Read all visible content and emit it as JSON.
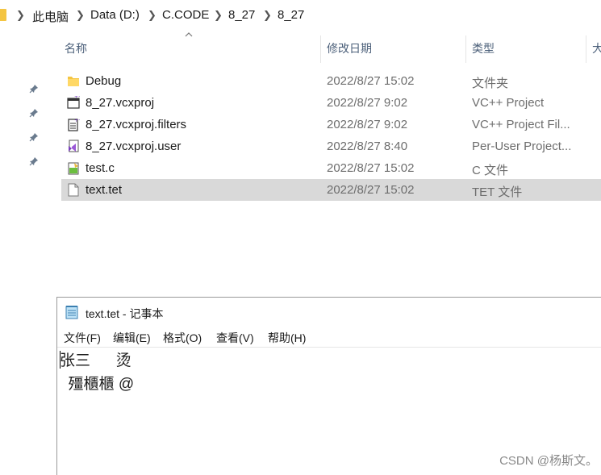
{
  "breadcrumb": [
    "此电脑",
    "Data (D:)",
    "C.CODE",
    "8_27",
    "8_27"
  ],
  "columns": {
    "name": "名称",
    "date": "修改日期",
    "type": "类型",
    "size": "大"
  },
  "files": [
    {
      "name": "Debug",
      "date": "2022/8/27 15:02",
      "type": "文件夹",
      "icon": "folder-icon"
    },
    {
      "name": "8_27.vcxproj",
      "date": "2022/8/27 9:02",
      "type": "VC++ Project",
      "icon": "vcxproj-icon"
    },
    {
      "name": "8_27.vcxproj.filters",
      "date": "2022/8/27 9:02",
      "type": "VC++ Project Fil...",
      "icon": "filters-icon"
    },
    {
      "name": "8_27.vcxproj.user",
      "date": "2022/8/27 8:40",
      "type": "Per-User Project...",
      "icon": "vs-user-icon"
    },
    {
      "name": "test.c",
      "date": "2022/8/27 15:02",
      "type": "C 文件",
      "icon": "c-file-icon"
    },
    {
      "name": "text.tet",
      "date": "2022/8/27 15:02",
      "type": "TET 文件",
      "icon": "blank-file-icon",
      "selected": true
    }
  ],
  "notepad": {
    "title": "text.tet - 记事本",
    "menu": [
      "文件(F)",
      "编辑(E)",
      "格式(O)",
      "查看(V)",
      "帮助(H)"
    ],
    "content_line1": "张三      烫",
    "content_line2": "  殭櫃櫃 @"
  },
  "watermark": "CSDN @杨斯文。",
  "colors": {
    "selection": "#d9d9d9",
    "folder": "#f4c542",
    "header_text": "#4c607a"
  }
}
